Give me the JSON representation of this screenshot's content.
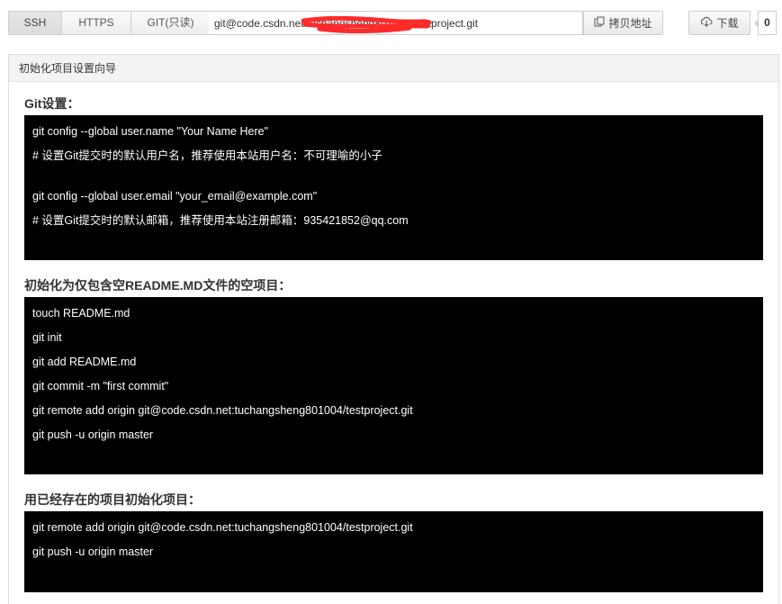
{
  "protocol_tabs": [
    {
      "label": "SSH",
      "active": true
    },
    {
      "label": "HTTPS",
      "active": false
    },
    {
      "label": "GIT(只读)",
      "active": false
    }
  ],
  "repo_url": {
    "value": "git@code.csdn.net:tuchangsheng801004/testproject.git"
  },
  "copy_button": {
    "label": "拷贝地址",
    "icon": "copy-icon"
  },
  "download_button": {
    "label": "下载",
    "icon": "cloud-download-icon"
  },
  "download_count": "0",
  "panel": {
    "title": "初始化项目设置向导"
  },
  "sections": [
    {
      "title": "Git设置：",
      "lines": [
        "git config --global user.name \"Your Name Here\"",
        "# 设置Git提交时的默认用户名，推荐使用本站用户名：不可理喻的小子",
        "",
        "git config --global user.email \"your_email@example.com\"",
        "# 设置Git提交时的默认邮箱，推荐使用本站注册邮箱：935421852@qq.com"
      ]
    },
    {
      "title": "初始化为仅包含空README.MD文件的空项目：",
      "lines": [
        "touch README.md",
        "git init",
        "git add README.md",
        "git commit -m \"first commit\"",
        "git remote add origin git@code.csdn.net:tuchangsheng801004/testproject.git",
        "git push -u origin master"
      ]
    },
    {
      "title": "用已经存在的项目初始化项目：",
      "lines": [
        "git remote add origin git@code.csdn.net:tuchangsheng801004/testproject.git",
        "git push -u origin master"
      ]
    }
  ],
  "colors": {
    "code_bg": "#000000",
    "code_text": "#ffffff",
    "redaction": "#ff2a2a"
  }
}
